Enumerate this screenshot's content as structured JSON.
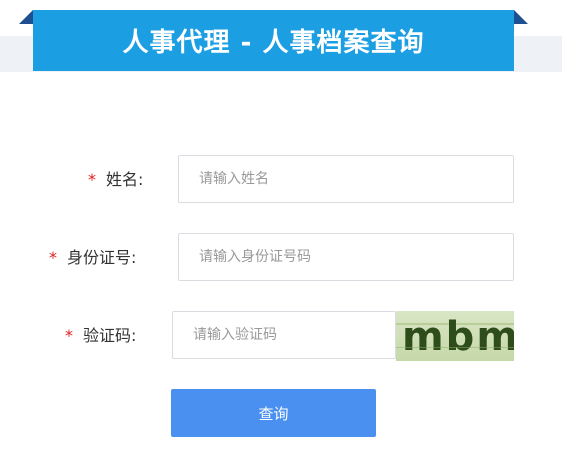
{
  "header": {
    "title": "人事代理 - 人事档案查询"
  },
  "form": {
    "name": {
      "required_mark": "*",
      "label": "姓名:",
      "placeholder": "请输入姓名"
    },
    "id_number": {
      "required_mark": "*",
      "label": "身份证号:",
      "placeholder": "请输入身份证号码"
    },
    "captcha": {
      "required_mark": "*",
      "label": "验证码:",
      "placeholder": "请输入验证码",
      "image_text": "mbml"
    },
    "submit_label": "查询"
  },
  "colors": {
    "banner": "#1b9ee2",
    "banner_fold": "#1e4f91",
    "button": "#4a90f0",
    "required": "#e02020"
  }
}
